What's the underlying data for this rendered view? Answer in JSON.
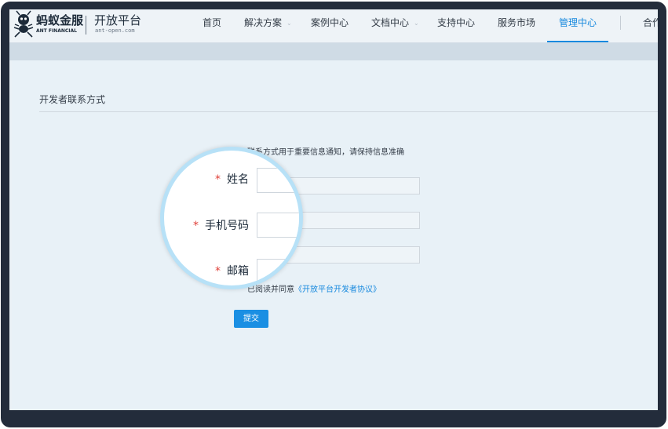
{
  "header": {
    "brand_cn": "蚂蚁金服",
    "brand_en": "ANT FINANCIAL",
    "platform_cn": "开放平台",
    "platform_en": "ant-open.com",
    "nav": [
      {
        "label": "首页",
        "has_dropdown": false,
        "active": false
      },
      {
        "label": "解决方案",
        "has_dropdown": true,
        "active": false
      },
      {
        "label": "案例中心",
        "has_dropdown": false,
        "active": false
      },
      {
        "label": "文档中心",
        "has_dropdown": true,
        "active": false
      },
      {
        "label": "支持中心",
        "has_dropdown": false,
        "active": false
      },
      {
        "label": "服务市场",
        "has_dropdown": false,
        "active": false
      },
      {
        "label": "管理中心",
        "has_dropdown": false,
        "active": true
      },
      {
        "label": "合作",
        "has_dropdown": false,
        "active": false
      }
    ],
    "chevron": "⌄"
  },
  "section": {
    "title": "开发者联系方式"
  },
  "form": {
    "notice": "联系方式用于重要信息通知，请保持信息准确",
    "required_mark": "*",
    "fields": [
      {
        "label": "姓名",
        "value": ""
      },
      {
        "label": "手机号码",
        "value": ""
      },
      {
        "label": "邮箱",
        "value": ""
      }
    ],
    "agree_prefix": "已阅读并同意",
    "agree_link": "《开放平台开发者协议》",
    "submit_label": "提交"
  },
  "colors": {
    "accent": "#1789de",
    "required": "#e0413a",
    "magnifier_ring": "#b7e1f7",
    "bezel": "#232c3b"
  }
}
